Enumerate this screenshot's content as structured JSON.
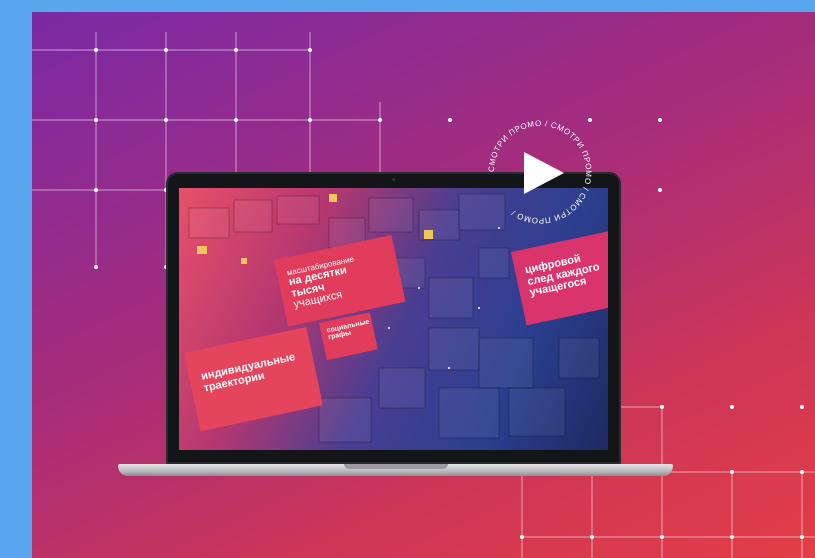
{
  "promo": {
    "ring_text": "СМОТРИ ПРОМО  /  СМОТРИ ПРОМО  /  СМОТРИ ПРОМО  /",
    "action": "play-video"
  },
  "screen": {
    "card_scale": {
      "small": "масштабирование",
      "line1_pre": "на ",
      "line1_strong": "десятки",
      "line2": "тысяч",
      "line3": "учащихся"
    },
    "card_trajectories": {
      "line1": "индивидуальные",
      "line2": "траектории"
    },
    "card_social": {
      "line1": "социальные",
      "line2": "графы"
    },
    "card_footprint": {
      "line1": "цифровой",
      "line2": "след каждого",
      "line3": "учащегося"
    }
  },
  "colors": {
    "page_background": "#5aa6ee",
    "banner_gradient_start": "#7a2aa6",
    "banner_gradient_end": "#e23d46",
    "card_accent": "#e23c5c",
    "grid_line": "#ffffff"
  }
}
